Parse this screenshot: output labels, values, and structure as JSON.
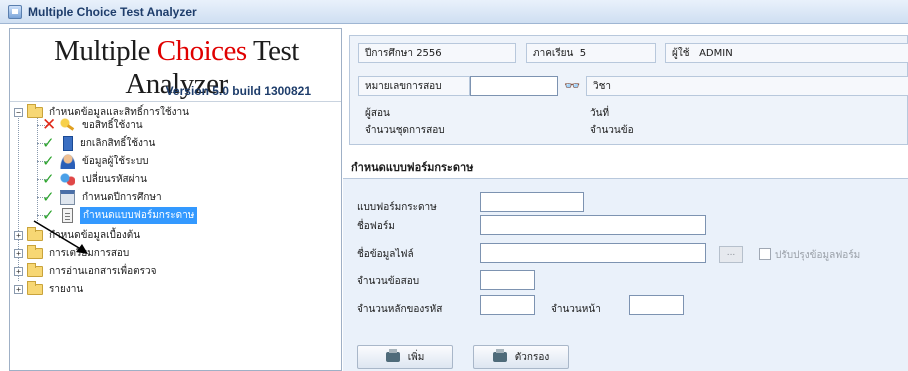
{
  "window": {
    "title": "Multiple Choice Test Analyzer"
  },
  "brand": {
    "part1": "Multiple ",
    "part2": "Choices",
    "part3": " Test Analyzer",
    "version": "Version 5.0  build 1300821"
  },
  "tree": [
    {
      "label": "กำหนดข้อมูลและสิทธิ์การใช้งาน",
      "expander": "−",
      "icon": "folder-icon"
    },
    {
      "label": "ขอสิทธิ์ใช้งาน",
      "status": "x-mark-icon",
      "icon": "key-icon"
    },
    {
      "label": "ยกเลิกสิทธิ์ใช้งาน",
      "status": "check-icon",
      "icon": "trash-icon"
    },
    {
      "label": "ข้อมูลผู้ใช้ระบบ",
      "status": "check-icon",
      "icon": "user-icon"
    },
    {
      "label": "เปลี่ยนรหัสผ่าน",
      "status": "check-icon",
      "icon": "keys-icon"
    },
    {
      "label": "กำหนดปีการศึกษา",
      "status": "check-icon",
      "icon": "calendar-icon"
    },
    {
      "label": "กำหนดแบบฟอร์มกระดาษ",
      "status": "check-icon",
      "icon": "document-icon",
      "selected": true
    },
    {
      "label": "กำหนดข้อมูลเบื้องต้น",
      "expander": "+",
      "icon": "folder-icon"
    },
    {
      "label": "การเตรียมการสอบ",
      "expander": "+",
      "icon": "folder-icon"
    },
    {
      "label": "การอ่านเอกสารเพื่อตรวจ",
      "expander": "+",
      "icon": "folder-icon"
    },
    {
      "label": "รายงาน",
      "expander": "+",
      "icon": "folder-icon"
    }
  ],
  "info": {
    "year_label": "ปีการศึกษา",
    "year_value": "2556",
    "term_label": "ภาคเรียน",
    "term_value": "5",
    "user_label": "ผู้ใช้",
    "user_value": "ADMIN",
    "exam_no_label": "หมายเลขการสอบ",
    "exam_no_value": "",
    "subject_label": "วิชา",
    "teacher_label": "ผู้สอน",
    "sets_label": "จำนวนชุดการสอบ",
    "date_label": "วันที่",
    "items_label": "จำนวนข้อ"
  },
  "section": {
    "title": "กำหนดแบบฟอร์มกระดาษ"
  },
  "form": {
    "paper_form_label": "แบบฟอร์มกระดาษ",
    "form_name_label": "ชื่อฟอร์ม",
    "data_file_label": "ชื่อข้อมูลไฟล์",
    "browse_label": "...",
    "update_checkbox_label": "ปรับปรุงข้อมูลฟอร์ม",
    "question_count_label": "จำนวนข้อสอบ",
    "code_digits_label": "จำนวนหลักของรหัส",
    "page_count_label": "จำนวนหน้า",
    "paper_form_value": "",
    "form_name_value": "",
    "data_file_value": "",
    "question_count_value": "",
    "code_digits_value": "",
    "page_count_value": ""
  },
  "buttons": {
    "add": "เพิ่ม",
    "filter": "ตัวกรอง"
  }
}
